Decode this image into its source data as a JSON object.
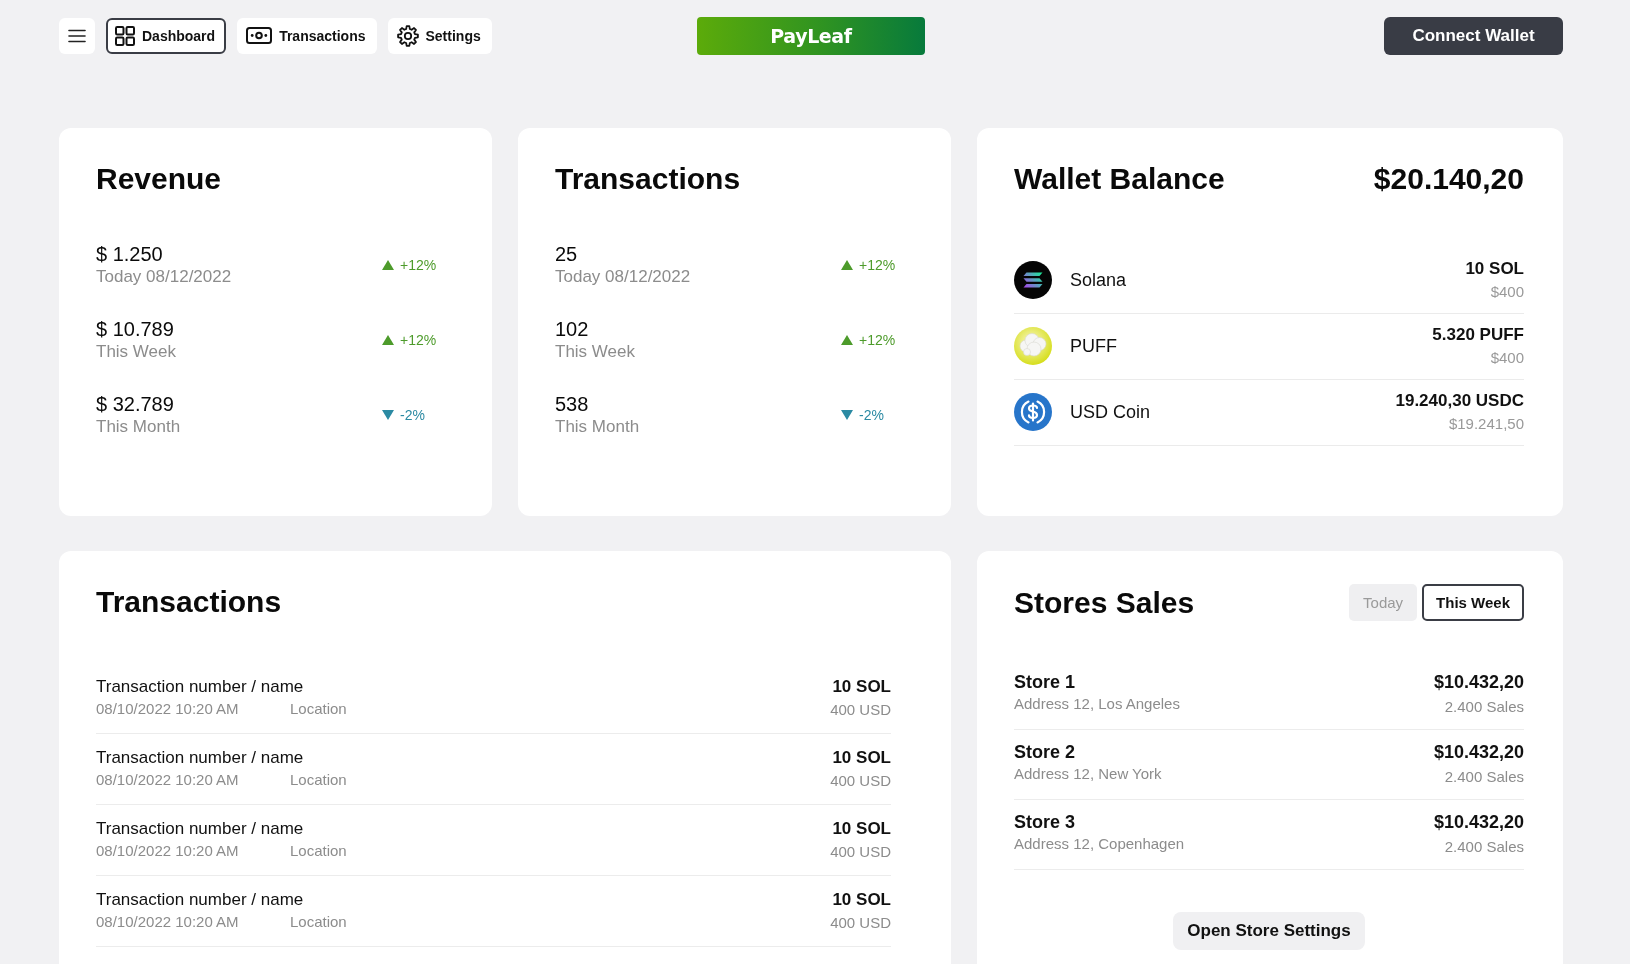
{
  "nav": {
    "tabs": [
      {
        "label": "Dashboard",
        "selected": true
      },
      {
        "label": "Transactions",
        "selected": false
      },
      {
        "label": "Settings",
        "selected": false
      }
    ]
  },
  "logo": {
    "text": "PayLeaf"
  },
  "connect_button": {
    "label": "Connect Wallet"
  },
  "revenue": {
    "title": "Revenue",
    "stats": [
      {
        "value": "$ 1.250",
        "period": "Today 08/12/2022",
        "kind": "up",
        "change": "+12%"
      },
      {
        "value": "$ 10.789",
        "period": "This Week",
        "kind": "up",
        "change": "+12%"
      },
      {
        "value": "$ 32.789",
        "period": "This Month",
        "kind": "down",
        "change": "-2%"
      }
    ]
  },
  "transactions_summary": {
    "title": "Transactions",
    "stats": [
      {
        "value": "25",
        "period": "Today 08/12/2022",
        "kind": "up",
        "change": "+12%"
      },
      {
        "value": "102",
        "period": "This Week",
        "kind": "up",
        "change": "+12%"
      },
      {
        "value": "538",
        "period": "This Month",
        "kind": "down",
        "change": "-2%"
      }
    ]
  },
  "wallet": {
    "title": "Wallet Balance",
    "total": "$20.140,20",
    "tokens": [
      {
        "name": "Solana",
        "amount": "10 SOL",
        "usd": "$400"
      },
      {
        "name": "PUFF",
        "amount": "5.320 PUFF",
        "usd": "$400"
      },
      {
        "name": "USD Coin",
        "amount": "19.240,30 USDC",
        "usd": "$19.241,50"
      }
    ]
  },
  "transactions": {
    "title": "Transactions",
    "rows": [
      {
        "name": "Transaction number / name",
        "datetime": "08/10/2022 10:20 AM",
        "location": "Location",
        "amount": "10 SOL",
        "usd": "400 USD"
      },
      {
        "name": "Transaction number / name",
        "datetime": "08/10/2022 10:20 AM",
        "location": "Location",
        "amount": "10 SOL",
        "usd": "400 USD"
      },
      {
        "name": "Transaction number / name",
        "datetime": "08/10/2022 10:20 AM",
        "location": "Location",
        "amount": "10 SOL",
        "usd": "400 USD"
      },
      {
        "name": "Transaction number / name",
        "datetime": "08/10/2022 10:20 AM",
        "location": "Location",
        "amount": "10 SOL",
        "usd": "400 USD"
      }
    ]
  },
  "stores": {
    "title": "Stores Sales",
    "filters": [
      {
        "label": "Today",
        "selected": false
      },
      {
        "label": "This Week",
        "selected": true
      }
    ],
    "rows": [
      {
        "name": "Store 1",
        "address": "Address 12, Los Angeles",
        "total": "$10.432,20",
        "sales": "2.400 Sales"
      },
      {
        "name": "Store 2",
        "address": "Address 12, New York",
        "total": "$10.432,20",
        "sales": "2.400 Sales"
      },
      {
        "name": "Store 3",
        "address": "Address 12, Copenhagen",
        "total": "$10.432,20",
        "sales": "2.400 Sales"
      }
    ],
    "button": "Open Store Settings"
  }
}
